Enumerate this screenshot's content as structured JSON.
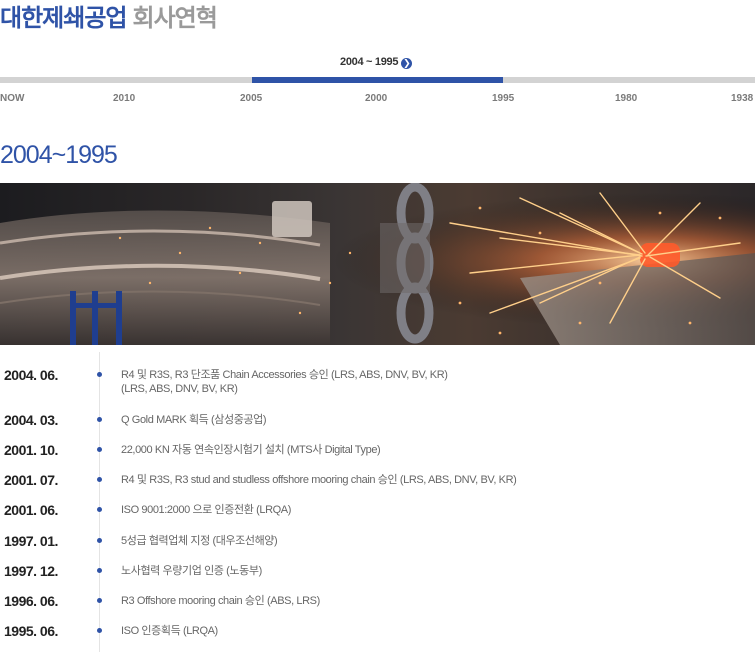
{
  "header": {
    "company": "대한제쇄공업",
    "page_title": "회사연혁"
  },
  "timeline_nav": {
    "active_range_label": "2004 ~ 1995",
    "ticks": [
      "NOW",
      "2010",
      "2005",
      "2000",
      "1995",
      "1980",
      "1938"
    ],
    "colors": {
      "active": "#2f53a7",
      "track": "#d3d3d3"
    }
  },
  "section": {
    "heading": "2004~1995"
  },
  "events": [
    {
      "date": "2004. 06.",
      "text": "R4 및 R3S, R3 단조품 Chain Accessories 승인 (LRS, ABS, DNV, BV, KR)",
      "text2": "(LRS, ABS, DNV, BV, KR)"
    },
    {
      "date": "2004. 03.",
      "text": "Q Gold MARK 획득 (삼성중공업)"
    },
    {
      "date": "2001. 10.",
      "text": "22,000 KN 자동 연속인장시험기 설치 (MTS사 Digital Type)"
    },
    {
      "date": "2001. 07.",
      "text": "R4 및 R3S, R3 stud and studless offshore mooring chain 승인 (LRS, ABS, DNV, BV, KR)"
    },
    {
      "date": "2001. 06.",
      "text": "ISO 9001:2000 으로 인증전환 (LRQA)"
    },
    {
      "date": "1997. 01.",
      "text": "5성급 협력업체 지정 (대우조선해양)"
    },
    {
      "date": "1997. 12.",
      "text": "노사협력 우량기업 인증 (노동부)"
    },
    {
      "date": "1996. 06.",
      "text": "R3 Offshore mooring chain 승인 (ABS, LRS)"
    },
    {
      "date": "1995. 06.",
      "text": "ISO 인증획득 (LRQA)"
    }
  ]
}
